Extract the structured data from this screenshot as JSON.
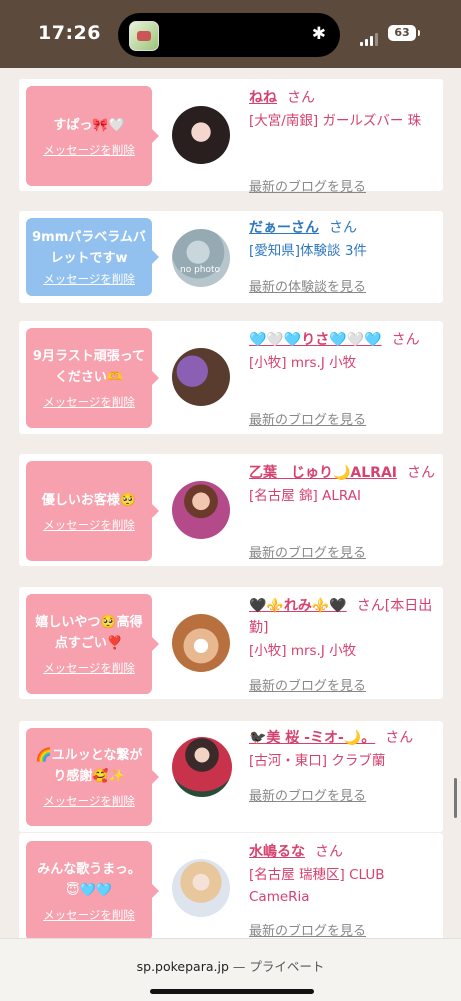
{
  "status": {
    "time": "17:26",
    "battery": "63"
  },
  "browser": {
    "domain": "sp.pokepara.jp",
    "separator": " — ",
    "mode": "プライベート"
  },
  "delete_label": "メッセージを削除",
  "san": "さん",
  "rows": [
    {
      "message": "すぱっ🎀🤍",
      "name": "ねね",
      "shop": "[大宮/南銀] ガールズバー 珠",
      "link": "最新のブログを見る"
    },
    {
      "message": "9mmパラベラムバレットですw",
      "name": "だぁーさん",
      "shop": "[愛知県]体験談 3件",
      "link": "最新の体験談を見る",
      "avatar_text": "no photo"
    },
    {
      "message": "9月ラスト頑張ってください🫶",
      "name": "🩵🤍🩵りさ🩵🤍🩵",
      "shop": "[小牧] mrs.J 小牧",
      "link": "最新のブログを見る"
    },
    {
      "message": "優しいお客様🥺",
      "name": "乙葉　じゅり🌙ALRAI",
      "shop": "[名古屋 錦] ALRAI",
      "link": "最新のブログを見る"
    },
    {
      "message": "嬉しいやつ🥺高得点すごい❣️",
      "name": "🖤⚜️れみ⚜️🖤",
      "name_suffix": "さん[本日出勤]",
      "shop": "[小牧] mrs.J 小牧",
      "link": "最新のブログを見る"
    },
    {
      "message": "🌈ユルッとな繋がり感謝🥰✨",
      "name": "🐦‍⬛美 桜 -ミオ-🌙。",
      "shop": "[古河・東口] クラブ蘭",
      "link": "最新のブログを見る"
    },
    {
      "message": "みんな歌うまっ。😇🩵🩵",
      "name": "水嶋るな",
      "shop": "[名古屋 瑞穂区] CLUB CameRia",
      "link": "最新のブログを見る"
    }
  ]
}
